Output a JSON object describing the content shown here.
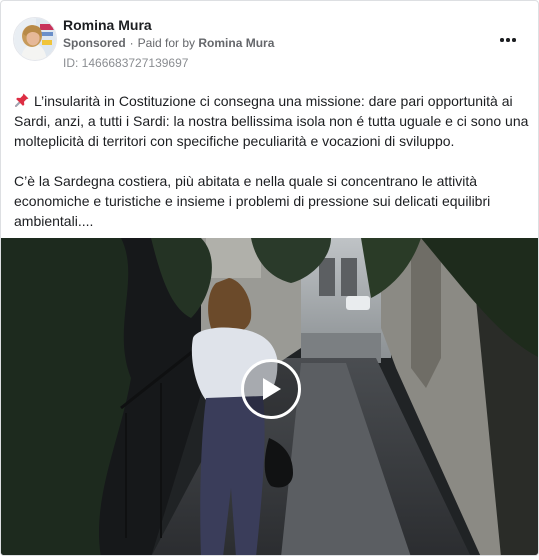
{
  "post": {
    "author": "Romina Mura",
    "sponsored_label": "Sponsored",
    "separator": "·",
    "paid_for_prefix": "Paid for by",
    "paid_for_name": "Romina Mura",
    "ad_id": "ID: 1466683727139697",
    "paragraph_1": "L’insularità in Costituzione ci consegna una missione: dare pari opportunità ai Sardi, anzi, a tutti i Sardi: la nostra bellissima isola non é tutta uguale e ci sono una molteplicità di territori con specifiche peculiarità e vocazioni di sviluppo.",
    "paragraph_2": "C’è la Sardegna costiera, più abitata e nella quale si concentrano le attività economiche e turistiche e insieme i problemi di pressione sui delicati equilibri ambientali....",
    "icons": {
      "pin": "pushpin-icon",
      "more": "more-options-icon",
      "play": "play-icon"
    }
  }
}
